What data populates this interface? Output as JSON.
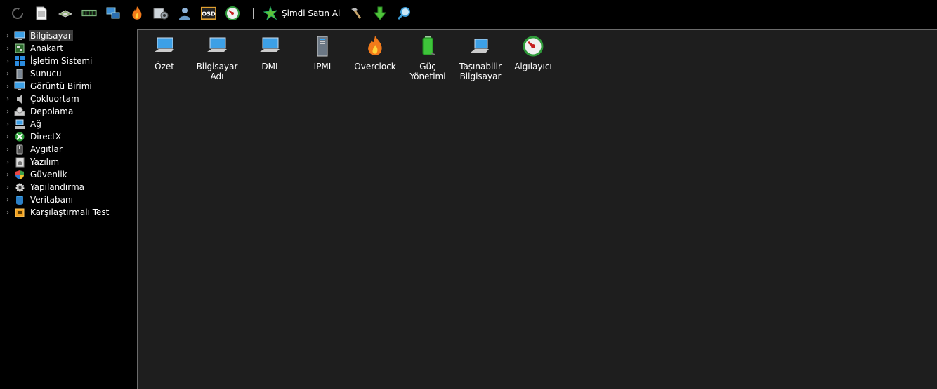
{
  "toolbar": {
    "buttons": [
      {
        "name": "refresh-icon"
      },
      {
        "name": "report-icon"
      },
      {
        "name": "cpu-icon"
      },
      {
        "name": "memory-icon"
      },
      {
        "name": "network-icon"
      },
      {
        "name": "flame-icon"
      },
      {
        "name": "settings-icon"
      },
      {
        "name": "user-icon"
      },
      {
        "name": "osd-icon",
        "text": "OSD"
      },
      {
        "name": "gauge-icon"
      }
    ],
    "buy_label": "Şimdi Satın Al"
  },
  "tree": {
    "items": [
      {
        "label": "Bilgisayar",
        "icon": "computer-icon",
        "selected": true
      },
      {
        "label": "Anakart",
        "icon": "motherboard-icon"
      },
      {
        "label": "İşletim Sistemi",
        "icon": "windows-icon"
      },
      {
        "label": "Sunucu",
        "icon": "server-icon"
      },
      {
        "label": "Görüntü Birimi",
        "icon": "display-icon"
      },
      {
        "label": "Çokluortam",
        "icon": "speaker-icon"
      },
      {
        "label": "Depolama",
        "icon": "storage-icon"
      },
      {
        "label": "Ağ",
        "icon": "network-icon"
      },
      {
        "label": "DirectX",
        "icon": "xbox-icon"
      },
      {
        "label": "Aygıtlar",
        "icon": "device-icon"
      },
      {
        "label": "Yazılım",
        "icon": "software-icon"
      },
      {
        "label": "Güvenlik",
        "icon": "shield-icon"
      },
      {
        "label": "Yapılandırma",
        "icon": "gear-icon"
      },
      {
        "label": "Veritabanı",
        "icon": "database-icon"
      },
      {
        "label": "Karşılaştırmalı Test",
        "icon": "benchmark-icon"
      }
    ]
  },
  "content": {
    "items": [
      {
        "label": "Özet",
        "icon": "computer-icon"
      },
      {
        "label": "Bilgisayar Adı",
        "icon": "computer-icon"
      },
      {
        "label": "DMI",
        "icon": "computer-icon"
      },
      {
        "label": "IPMI",
        "icon": "server-icon"
      },
      {
        "label": "Overclock",
        "icon": "flame-icon"
      },
      {
        "label": "Güç Yönetimi",
        "icon": "battery-icon"
      },
      {
        "label": "Taşınabilir Bilgisayar",
        "icon": "laptop-icon"
      },
      {
        "label": "Algılayıcı",
        "icon": "gauge-icon"
      }
    ]
  }
}
